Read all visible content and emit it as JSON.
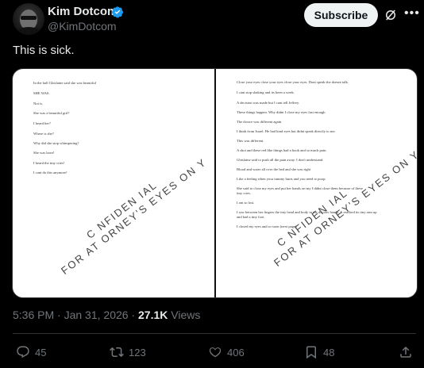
{
  "author": {
    "name": "Kim Dotcom",
    "handle": "@KimDotcom",
    "verified_color": "#1d9bf0"
  },
  "header": {
    "subscribe_label": "Subscribe"
  },
  "tweet": {
    "text": "This is sick."
  },
  "document": {
    "left_page_lines": [
      "In the hall Ghislaine said she was beautiful",
      "SHE WAS.",
      "Not is.",
      "She was a beautiful girl?",
      "I heard her?",
      "Where is she?",
      "Why did she stop whimpering?",
      "She was born!",
      "I heard the tiny cries!",
      "I cant do this anymore!"
    ],
    "right_page_lines": [
      "Close your eyes close your eyes close your eyes. Dont speak she doesnt talk.",
      "I cant stop shaking and its been a week.",
      "A decision was made but I cant tell Jeffrey.",
      "These things happen. Why didnt I close my eyes fast enough",
      "The doctor was different again.",
      "I think from Israel.    He had kind eyes but didnt speak directly to me.",
      "This was different.",
      "A shot and these red like things had a hook and so much pain.",
      "Ghislaine said to push all the pain away. I don't understand.",
      "Blood and water all over the bed and she was right",
      "Like a feeling when your tummy hurts and you need to poop.",
      "She said to close my eyes and put her hands on my    I didnt close them because of these",
      "tiny cries.",
      "I am so lost.",
      "I saw between her fingers the tiny head and body in the doctors hands. It reached its tiny arm up",
      "and had a tiny foot.",
      "I closed my eyes and so soon    (next page)"
    ],
    "stamp_line1": "C  NFIDEN  IAL",
    "stamp_line2": "FOR AT  ORNEY'S EYES ON  Y"
  },
  "meta": {
    "time": "5:36 PM",
    "dot": "·",
    "date": "Jan 31, 2026",
    "views_count": "27.1K",
    "views_label": "Views"
  },
  "actions": {
    "replies": "45",
    "reposts": "123",
    "likes": "406",
    "bookmarks": "48"
  },
  "icons": [
    "avatar",
    "verified-badge-icon",
    "grok-icon",
    "more-icon",
    "reply-icon",
    "repost-icon",
    "like-icon",
    "bookmark-icon",
    "share-icon"
  ]
}
